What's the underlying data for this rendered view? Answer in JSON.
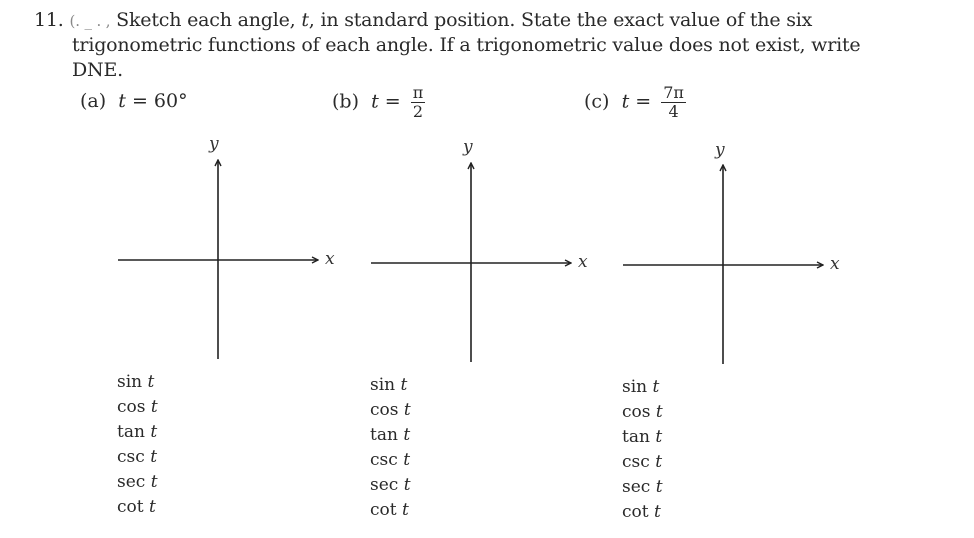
{
  "problem": {
    "number": "11.",
    "smudge": "(․  _    ․ ,",
    "line1_text": "Sketch each angle, ",
    "line1_var": "t",
    "line1_rest": ", in standard position. State the exact value of the six",
    "line2": "trigonometric functions of each angle.  If a trigonometric value does not exist, write",
    "line3": "DNE."
  },
  "parts": [
    {
      "label": "(a)",
      "var": "t",
      "equals": "=",
      "value": "60°",
      "axes": {
        "x_label": "x",
        "y_label": "y"
      },
      "functions": [
        "sin",
        "cos",
        "tan",
        "csc",
        "sec",
        "cot"
      ],
      "arg": "t"
    },
    {
      "label": "(b)",
      "var": "t",
      "equals": "=",
      "numerator": "π",
      "denominator": "2",
      "axes": {
        "x_label": "x",
        "y_label": "y"
      },
      "functions": [
        "sin",
        "cos",
        "tan",
        "csc",
        "sec",
        "cot"
      ],
      "arg": "t"
    },
    {
      "label": "(c)",
      "var": "t",
      "equals": "=",
      "numerator": "7π",
      "denominator": "4",
      "axes": {
        "x_label": "x",
        "y_label": "y"
      },
      "functions": [
        "sin",
        "cos",
        "tan",
        "csc",
        "sec",
        "cot"
      ],
      "arg": "t"
    }
  ]
}
